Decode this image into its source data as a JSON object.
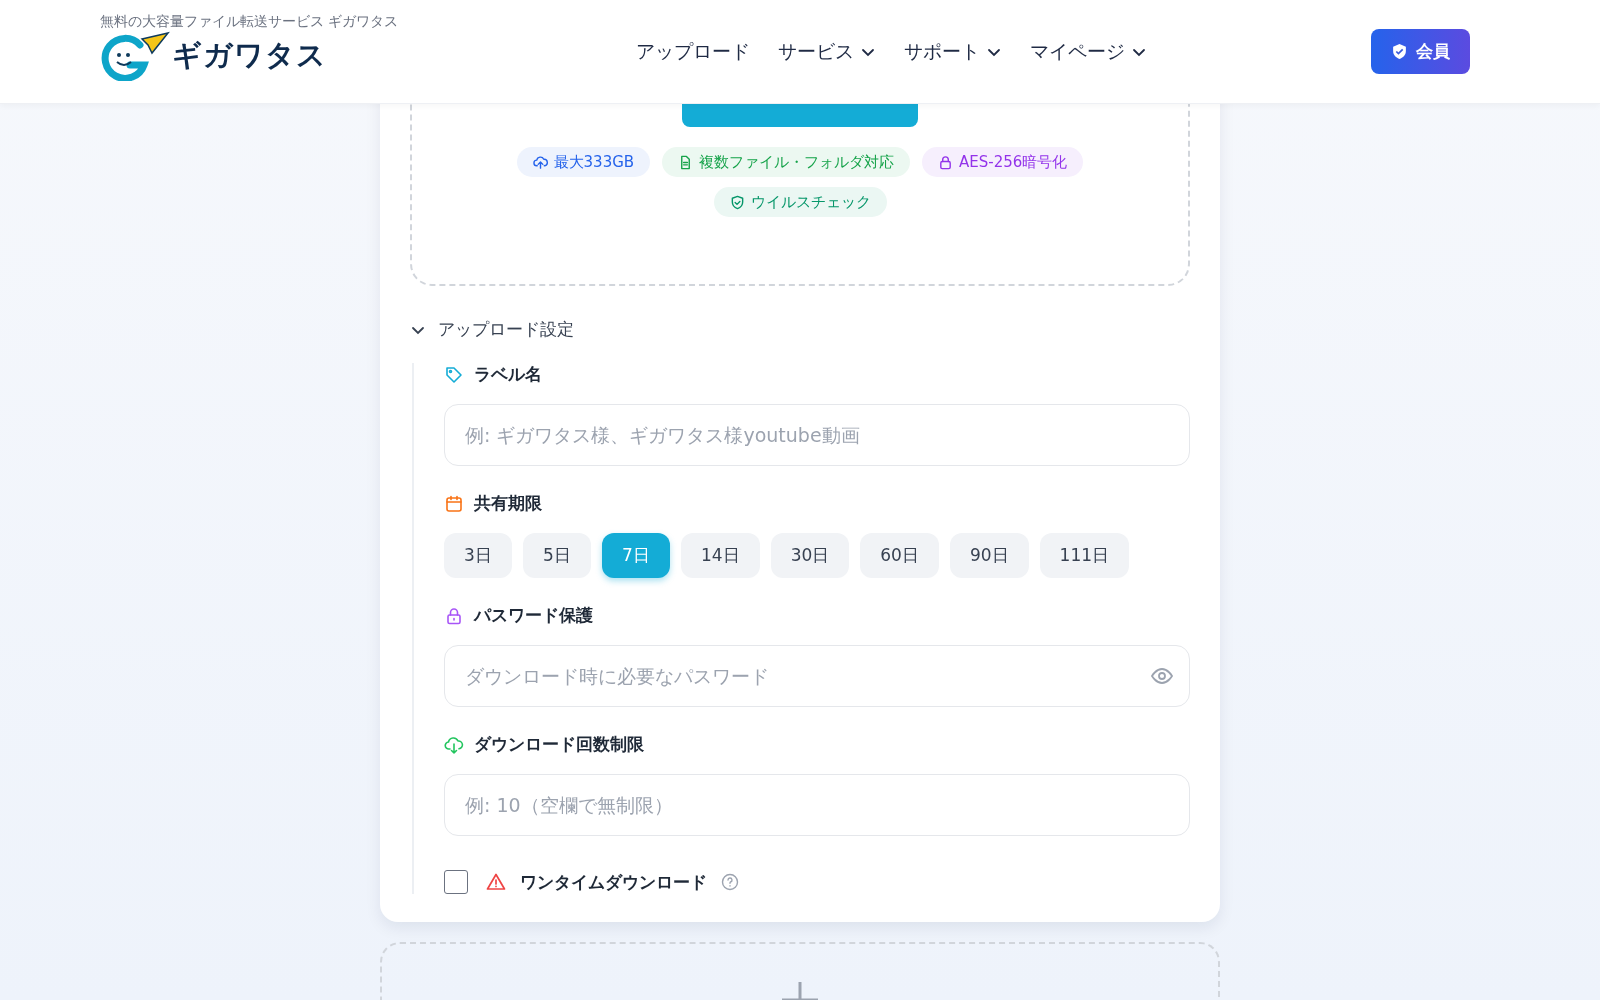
{
  "header": {
    "tagline": "無料の大容量ファイル転送サービス ギガワタス",
    "logo_text": "ギガワタス",
    "nav": [
      {
        "label": "アップロード",
        "dropdown": false
      },
      {
        "label": "サービス",
        "dropdown": true
      },
      {
        "label": "サポート",
        "dropdown": true
      },
      {
        "label": "マイページ",
        "dropdown": true
      }
    ],
    "member_button": "会員"
  },
  "upload": {
    "features": [
      {
        "label": "最大333GB",
        "color": "#2563eb"
      },
      {
        "label": "複数ファイル・フォルダ対応",
        "color": "#16a34a"
      },
      {
        "label": "AES-256暗号化",
        "color": "#9333ea"
      },
      {
        "label": "ウイルスチェック",
        "color": "#059669"
      }
    ]
  },
  "settings": {
    "title": "アップロード設定",
    "expanded": true,
    "fields": [
      {
        "kind": "text",
        "label": "ラベル名",
        "placeholder": "例: ギガワタス様、ギガワタス様youtube動画"
      },
      {
        "kind": "choices",
        "label": "共有期限",
        "options": [
          {
            "label": "3日",
            "selected": false
          },
          {
            "label": "5日",
            "selected": false
          },
          {
            "label": "7日",
            "selected": true
          },
          {
            "label": "14日",
            "selected": false
          },
          {
            "label": "30日",
            "selected": false
          },
          {
            "label": "60日",
            "selected": false
          },
          {
            "label": "90日",
            "selected": false
          },
          {
            "label": "111日",
            "selected": false
          }
        ]
      },
      {
        "kind": "password",
        "label": "パスワード保護",
        "placeholder": "ダウンロード時に必要なパスワード"
      },
      {
        "kind": "text",
        "label": "ダウンロード回数制限",
        "placeholder": "例: 10（空欄で無制限）"
      },
      {
        "kind": "checkbox",
        "label": "ワンタイムダウンロード",
        "checked": false
      }
    ]
  }
}
